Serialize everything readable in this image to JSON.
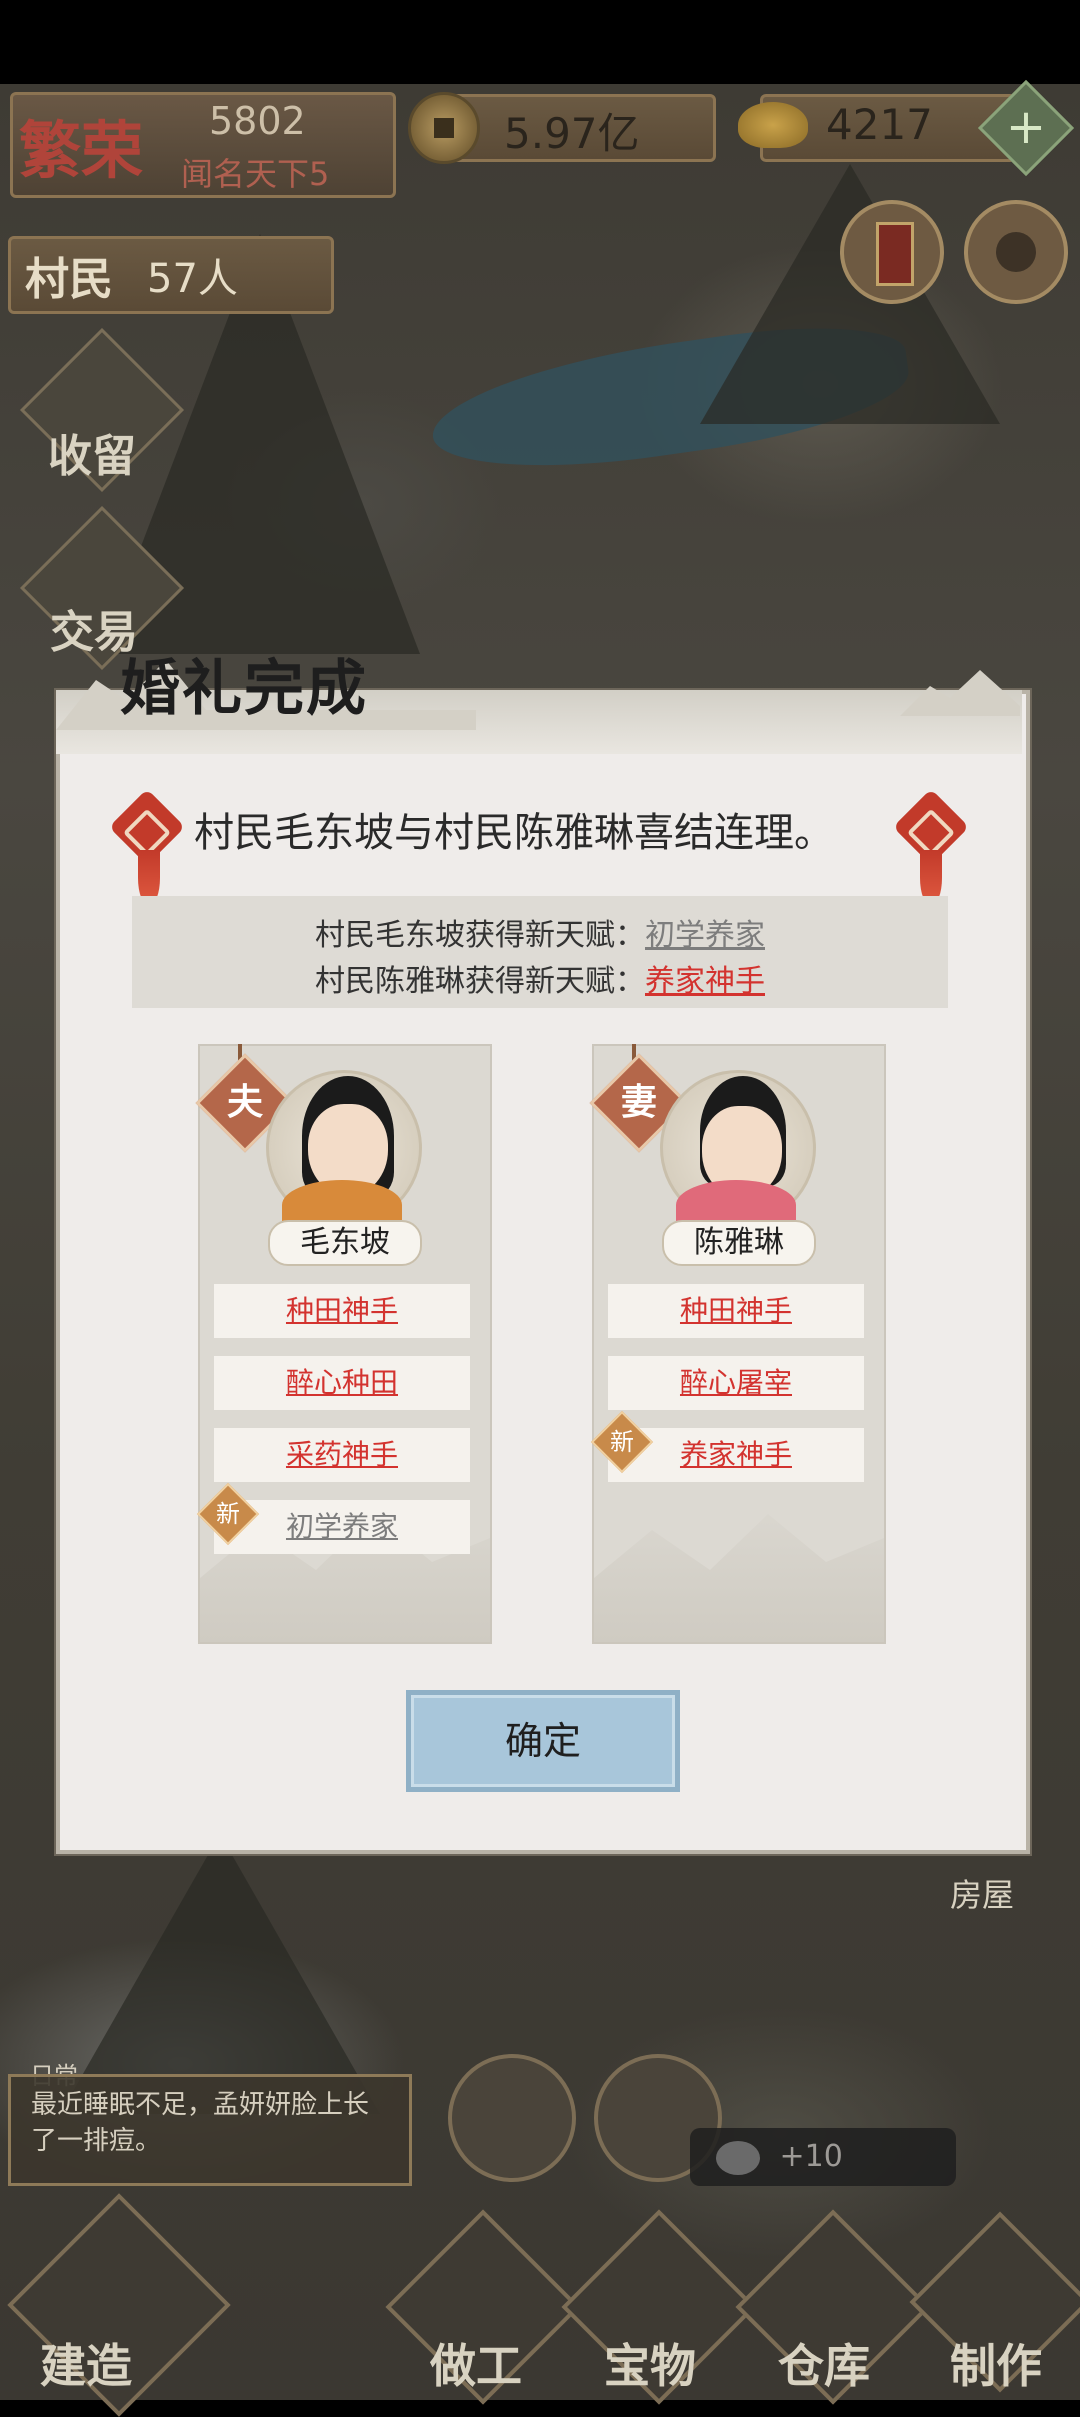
{
  "hud": {
    "fame_title": "繁荣",
    "fame_value": "5802",
    "fame_rank": "闻名天下5",
    "coins": "5.97亿",
    "gold": "4217",
    "plus": "+",
    "villagers_label": "村民",
    "villagers_count": "57人"
  },
  "side": {
    "shelter": "收留",
    "trade": "交易"
  },
  "modal": {
    "title": "婚礼完成",
    "message": "村民毛东坡与村民陈雅琳喜结连理。",
    "talent_line1_prefix": "村民毛东坡获得新天赋：",
    "talent_line1_value": "初学养家",
    "talent_line2_prefix": "村民陈雅琳获得新天赋：",
    "talent_line2_value": "养家神手",
    "husband": {
      "badge": "夫",
      "name": "毛东坡",
      "skills": [
        "种田神手",
        "醉心种田",
        "采药神手",
        "初学养家"
      ],
      "new_badge": "新"
    },
    "wife": {
      "badge": "妻",
      "name": "陈雅琳",
      "skills": [
        "种田神手",
        "醉心屠宰",
        "养家神手"
      ],
      "new_badge": "新"
    },
    "confirm": "确定"
  },
  "bottom": {
    "news_tag": "日常",
    "news_text": "最近睡眠不足，孟妍妍脸上长了一排痘。",
    "reward_text": "+10",
    "house": "房屋",
    "build": "建造",
    "work": "做工",
    "treasure": "宝物",
    "warehouse": "仓库",
    "craft": "制作"
  },
  "colors": {
    "accent_red": "#d3332f",
    "confirm_blue": "#a8c6da",
    "modal_bg": "#efecea"
  }
}
